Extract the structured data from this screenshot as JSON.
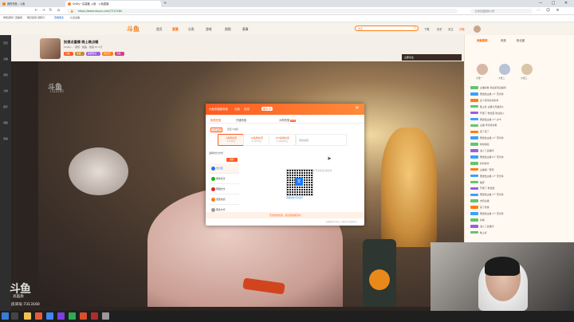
{
  "browser": {
    "tabs": [
      {
        "label": "我的作品 - 斗鱼",
        "active": false,
        "icon_color": "#ff7d12"
      },
      {
        "label": "SinDy~高温暖_斗鱼 · 斗鱼直播",
        "active": true,
        "icon_color": "#ff7d12"
      }
    ],
    "new_tab_label": "+",
    "url": "https://www.douyu.com/7313160",
    "search_placeholder": "红米巨型装修公司",
    "window_buttons": [
      "—",
      "□",
      "✕"
    ],
    "bookmarks": [
      "你知道吗？直播间",
      "每日签到  领积分",
      "查看更多",
      "认证主播"
    ]
  },
  "site": {
    "logo": "斗鱼",
    "nav": [
      "首页",
      "直播",
      "分类",
      "游戏",
      "视频",
      "赛事"
    ],
    "active_nav": "直播",
    "search_placeholder": "搜索",
    "header_right": [
      "下载",
      "历史",
      "关注",
      "开播"
    ]
  },
  "left_rail": [
    "首页",
    "直播",
    "游戏",
    "分类",
    "娱乐",
    "视频",
    "赛事"
  ],
  "room": {
    "title": "别想点重播 晚上晚点睡",
    "meta": "SinDy~  ·  颜值  ·  舞蹈  ·  热度 97.2万",
    "badges": [
      {
        "label": "直播中",
        "color": "#ff5a1f"
      },
      {
        "label": "等级",
        "color": "#c58a30"
      },
      {
        "label": "超级粉丝",
        "color": "#9b5de5"
      },
      {
        "label": "粉丝团",
        "color": "#ff7d12"
      },
      {
        "label": "贵族",
        "color": "#d13d8a"
      }
    ],
    "video_top_label": "立即关注"
  },
  "watermark": {
    "small_logo": "斗鱼",
    "small_id": "7313160",
    "logo": "斗鱼",
    "sub": "高画质",
    "id": "房间号:7313160"
  },
  "right_panel": {
    "tabs": [
      "贡献周榜",
      "贵族",
      "粉丝团"
    ],
    "active_tab": "贡献周榜",
    "top_users": [
      "大佬一",
      "大佬二",
      "大佬三"
    ],
    "chat": [
      {
        "level_color": "#66c36f",
        "text": "主播好看 欢迎来到直播间"
      },
      {
        "level_color": "#3aa0ff",
        "text": "赠送给主播 1个 荧光棒"
      },
      {
        "level_color": "#ff7d12",
        "text": "这个音乐好好听呀"
      },
      {
        "level_color": "#66c36f",
        "text": "晚上好 主播今天播多久"
      },
      {
        "level_color": "#9b5de5",
        "text": "开通了 粉丝团 欢迎加入"
      },
      {
        "level_color": "#3aa0ff",
        "text": "赠送给主播 1个 办卡"
      },
      {
        "level_color": "#66c36f",
        "text": "主播 早点休息哦"
      },
      {
        "level_color": "#ff7d12",
        "text": "来了来了"
      },
      {
        "level_color": "#3aa0ff",
        "text": "赠送给主播 1个 荧光棒"
      },
      {
        "level_color": "#66c36f",
        "text": "哈哈哈哈"
      },
      {
        "level_color": "#9b5de5",
        "text": "进入了直播间"
      },
      {
        "level_color": "#3aa0ff",
        "text": "赠送给主播 6个 荧光棒"
      },
      {
        "level_color": "#66c36f",
        "text": "好听好听"
      },
      {
        "level_color": "#ff7d12",
        "text": "主播唱一首吧"
      },
      {
        "level_color": "#3aa0ff",
        "text": "赠送给主播 1个 荧光棒"
      },
      {
        "level_color": "#66c36f",
        "text": "晚安"
      },
      {
        "level_color": "#9b5de5",
        "text": "开通了 粉丝团"
      },
      {
        "level_color": "#3aa0ff",
        "text": "赠送给主播 1个 荧光棒"
      },
      {
        "level_color": "#66c36f",
        "text": "支持主播"
      },
      {
        "level_color": "#ff7d12",
        "text": "来了老弟"
      },
      {
        "level_color": "#3aa0ff",
        "text": "赠送给主播 1个 荧光棒"
      },
      {
        "level_color": "#66c36f",
        "text": "好看"
      },
      {
        "level_color": "#9b5de5",
        "text": "进入了直播间"
      },
      {
        "level_color": "#66c36f",
        "text": "晚上好"
      }
    ]
  },
  "modal": {
    "title": "大鱼充值服务窗",
    "header_tabs": [
      "充值",
      "鱼翅",
      "鱼丸卡"
    ],
    "active_header_tab": "鱼丸卡",
    "close": "✕",
    "tabs": [
      "鱼翅充值",
      "开通贵族",
      "大神充值"
    ],
    "active_tab": "鱼翅充值",
    "hot_tag": "HOT",
    "subtabs": [
      "充值鱼翅",
      "自定义充值"
    ],
    "active_subtab": "充值鱼翅",
    "packages": [
      {
        "name": "1鱼翅充值",
        "sub": "¥ 1.00元"
      },
      {
        "name": "10鱼翅充值",
        "sub": "¥ 10.00元"
      },
      {
        "name": "100鱼翅充值",
        "sub": "¥ 100.00元"
      }
    ],
    "custom_placeholder": "其他金额",
    "pay_label": "选择支付方式",
    "pay_selected_tag": "推荐",
    "pay_methods": [
      {
        "label": "支付宝",
        "color": "#1677ff"
      },
      {
        "label": "微信支付",
        "color": "#09bb07"
      },
      {
        "label": "网银支付",
        "color": "#e02424"
      },
      {
        "label": "话费充值",
        "color": "#ff7d12"
      },
      {
        "label": "更多方式",
        "color": "#999999"
      }
    ],
    "qr_tip": "打开支付宝扫码支付",
    "qr_note": "请使用支付宝扫码",
    "footer": "首次充值优惠，最高送鱼翅活动",
    "footer2": "充值即表示同意《斗鱼用户充值协议》"
  },
  "accent_color": "#ff5a1f"
}
